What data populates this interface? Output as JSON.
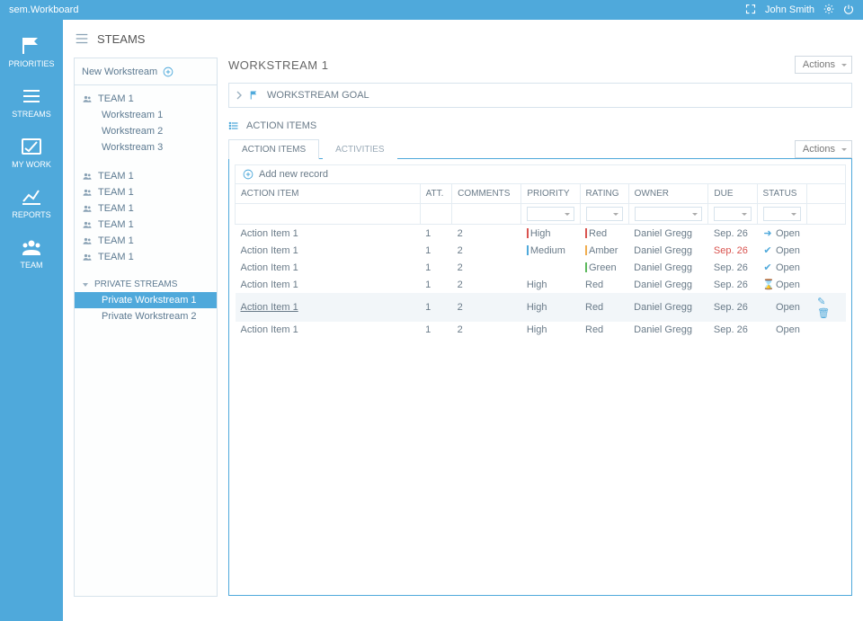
{
  "topbar": {
    "app": "sem.Workboard",
    "user": "John Smith"
  },
  "nav": [
    {
      "id": "priorities",
      "label": "PRIORITIES"
    },
    {
      "id": "streams",
      "label": "STREAMS"
    },
    {
      "id": "mywork",
      "label": "MY WORK"
    },
    {
      "id": "reports",
      "label": "REPORTS"
    },
    {
      "id": "team",
      "label": "TEAM"
    }
  ],
  "page_title": "STEAMS",
  "new_workstream": "New Workstream",
  "tree": {
    "team1": {
      "label": "TEAM 1",
      "children": [
        {
          "label": "Workstream 1"
        },
        {
          "label": "Workstream 2"
        },
        {
          "label": "Workstream 3"
        }
      ]
    },
    "others": [
      {
        "label": "TEAM 1"
      },
      {
        "label": "TEAM 1"
      },
      {
        "label": "TEAM 1"
      },
      {
        "label": "TEAM 1"
      },
      {
        "label": "TEAM 1"
      },
      {
        "label": "TEAM 1"
      }
    ],
    "private": {
      "label": "PRIVATE STREAMS",
      "children": [
        {
          "label": "Private Workstream 1",
          "selected": true
        },
        {
          "label": "Private Workstream 2"
        }
      ]
    }
  },
  "workstream": {
    "title": "WORKSTREAM 1",
    "actions": "Actions",
    "goal_label": "WORKSTREAM GOAL",
    "section": "ACTION ITEMS",
    "tabs": {
      "items": "ACTION ITEMS",
      "activities": "ACTIVITIES"
    },
    "add_record": "Add new record",
    "columns": {
      "action_item": "ACTION ITEM",
      "att": "ATT.",
      "comments": "COMMENTS",
      "priority": "PRIORITY",
      "rating": "RATING",
      "owner": "OWNER",
      "due": "DUE",
      "status": "STATUS"
    },
    "rows": [
      {
        "name": "Action Item 1",
        "att": "1",
        "comments": "2",
        "priority": "High",
        "pcolor": "red",
        "rating": "Red",
        "rcolor": "red",
        "owner": "Daniel Gregg",
        "due": "Sep. 26",
        "due_red": false,
        "status": "Open",
        "sicon": "arrow"
      },
      {
        "name": "Action Item 1",
        "att": "1",
        "comments": "2",
        "priority": "Medium",
        "pcolor": "blue",
        "rating": "Amber",
        "rcolor": "amber",
        "owner": "Daniel Gregg",
        "due": "Sep. 26",
        "due_red": true,
        "status": "Open",
        "sicon": "check"
      },
      {
        "name": "Action Item 1",
        "att": "1",
        "comments": "2",
        "priority": "",
        "pcolor": "",
        "rating": "Green",
        "rcolor": "green",
        "owner": "Daniel Gregg",
        "due": "Sep. 26",
        "due_red": false,
        "status": "Open",
        "sicon": "check"
      },
      {
        "name": "Action Item 1",
        "att": "1",
        "comments": "2",
        "priority": "High",
        "pcolor": "",
        "rating": "Red",
        "rcolor": "",
        "owner": "Daniel Gregg",
        "due": "Sep. 26",
        "due_red": false,
        "status": "Open",
        "sicon": "hour"
      },
      {
        "name": "Action Item 1",
        "att": "1",
        "comments": "2",
        "priority": "High",
        "pcolor": "",
        "rating": "Red",
        "rcolor": "",
        "owner": "Daniel Gregg",
        "due": "Sep. 26",
        "due_red": false,
        "status": "Open",
        "sicon": "",
        "hover": true
      },
      {
        "name": "Action Item 1",
        "att": "1",
        "comments": "2",
        "priority": "High",
        "pcolor": "",
        "rating": "Red",
        "rcolor": "",
        "owner": "Daniel Gregg",
        "due": "Sep. 26",
        "due_red": false,
        "status": "Open",
        "sicon": ""
      }
    ]
  }
}
